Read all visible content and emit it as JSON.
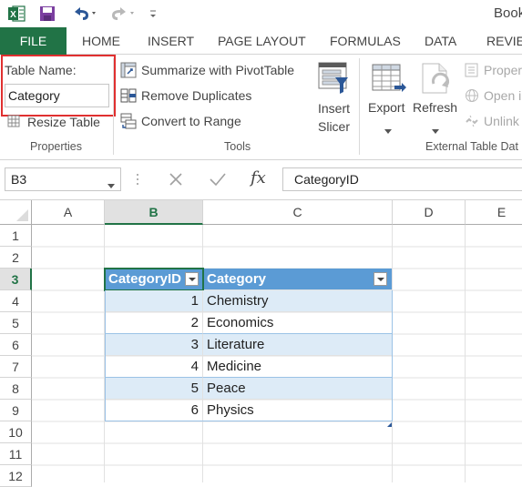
{
  "app": {
    "title_partial": "Book",
    "accent": "#217346"
  },
  "quick_access": {
    "icons": [
      "excel-logo-icon",
      "save-icon",
      "undo-icon",
      "redo-icon",
      "customize-icon"
    ]
  },
  "tabs": [
    {
      "label": "FILE"
    },
    {
      "label": "HOME"
    },
    {
      "label": "INSERT"
    },
    {
      "label": "PAGE LAYOUT"
    },
    {
      "label": "FORMULAS"
    },
    {
      "label": "DATA"
    },
    {
      "label": "REVIEW"
    }
  ],
  "ribbon": {
    "properties": {
      "table_name_label": "Table Name:",
      "table_name_value": "Category",
      "resize_label": "Resize Table",
      "group_label": "Properties",
      "highlight_color": "#e03030"
    },
    "tools": {
      "pivot_label": "Summarize with PivotTable",
      "remove_dup_label": "Remove Duplicates",
      "convert_label": "Convert to Range",
      "slicer_label_1": "Insert",
      "slicer_label_2": "Slicer",
      "group_label": "Tools"
    },
    "external": {
      "export_label": "Export",
      "refresh_label": "Refresh",
      "properties_label": "Proper",
      "open_label": "Open i",
      "unlink_label": "Unlink",
      "group_label": "External Table Dat"
    }
  },
  "formula_bar": {
    "name_box": "B3",
    "fx": "fx",
    "content": "CategoryID"
  },
  "grid": {
    "columns": [
      "A",
      "B",
      "C",
      "D",
      "E"
    ],
    "rows": [
      "1",
      "2",
      "3",
      "4",
      "5",
      "6",
      "7",
      "8",
      "9",
      "10",
      "11",
      "12"
    ],
    "table": {
      "header": [
        "CategoryID",
        "Category"
      ],
      "rows": [
        [
          "1",
          "Chemistry"
        ],
        [
          "2",
          "Economics"
        ],
        [
          "3",
          "Literature"
        ],
        [
          "4",
          "Medicine"
        ],
        [
          "5",
          "Peace"
        ],
        [
          "6",
          "Physics"
        ]
      ],
      "header_color": "#5b9bd5",
      "band_color": "#ddebf7"
    }
  }
}
